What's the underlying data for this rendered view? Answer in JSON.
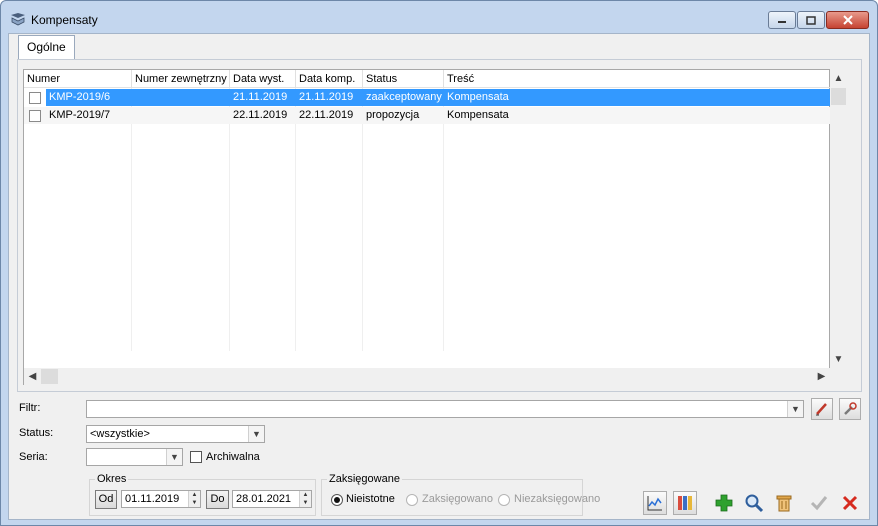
{
  "window": {
    "title": "Kompensaty",
    "minimize_glyph": "—",
    "maximize_glyph": "□",
    "close_glyph": "✕"
  },
  "tabs": [
    {
      "label": "Ogólne",
      "active": true
    }
  ],
  "grid": {
    "columns": [
      "Numer",
      "Numer zewnętrzny",
      "Data wyst.",
      "Data komp.",
      "Status",
      "Treść"
    ],
    "rows": [
      {
        "checked": false,
        "numer": "KMP-2019/6",
        "numer_zewnetrzny": "",
        "data_wyst": "21.11.2019",
        "data_komp": "21.11.2019",
        "status": "zaakceptowany",
        "tresc": "Kompensata",
        "selected": true
      },
      {
        "checked": false,
        "numer": "KMP-2019/7",
        "numer_zewnetrzny": "",
        "data_wyst": "22.11.2019",
        "data_komp": "22.11.2019",
        "status": "propozycja",
        "tresc": "Kompensata",
        "selected": false
      }
    ]
  },
  "filters": {
    "filtr_label": "Filtr:",
    "filtr_value": "",
    "status_label": "Status:",
    "status_value": "<wszystkie>",
    "seria_label": "Seria:",
    "seria_value": "",
    "archiwalna_label": "Archiwalna",
    "archiwalna_checked": false
  },
  "okres": {
    "title": "Okres",
    "od_label": "Od",
    "od_value": "01.11.2019",
    "do_label": "Do",
    "do_value": "28.01.2021"
  },
  "zaksiegowane": {
    "title": "Zaksięgowane",
    "options": [
      {
        "label": "Nieistotne",
        "selected": true,
        "enabled": true
      },
      {
        "label": "Zaksięgowano",
        "selected": false,
        "enabled": false
      },
      {
        "label": "Niezaksięgowano",
        "selected": false,
        "enabled": false
      }
    ]
  },
  "toolbar_icons": [
    "chart-icon",
    "columns-icon",
    "add-icon",
    "search-icon",
    "delete-icon",
    "confirm-icon",
    "cancel-icon"
  ],
  "colors": {
    "selection": "#3399ff",
    "add": "#2ea12e",
    "cancel": "#d62b1f"
  }
}
